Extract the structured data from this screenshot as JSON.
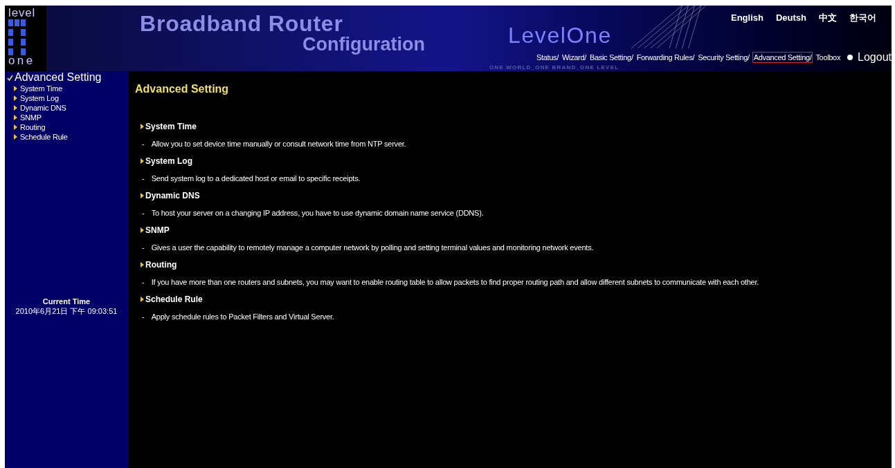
{
  "logo": {
    "top": "level",
    "bottom": "one"
  },
  "banner": {
    "title": "Broadband Router",
    "subtitle": "Configuration",
    "brand": "LevelOne",
    "slogan": "ONE WORLD_ONE BRAND_ONE LEVEL"
  },
  "languages": [
    "English",
    "Deutsh",
    "中文",
    "한국어"
  ],
  "nav": [
    {
      "label": "Status/",
      "selected": false
    },
    {
      "label": "Wizard/",
      "selected": false
    },
    {
      "label": "Basic Setting/",
      "selected": false
    },
    {
      "label": "Forwarding Rules/",
      "selected": false
    },
    {
      "label": "Security Setting/",
      "selected": false
    },
    {
      "label": "Advanced Setting/",
      "selected": true
    },
    {
      "label": "Toolbox",
      "selected": false
    }
  ],
  "logout": "Logout",
  "sidebar": {
    "title": "Advanced Setting",
    "items": [
      "System Time",
      "System Log",
      "Dynamic DNS",
      "SNMP",
      "Routing",
      "Schedule Rule"
    ],
    "clock_label": "Current Time",
    "clock_value": "2010年6月21日 下午 09:03:51"
  },
  "main": {
    "title": "Advanced Setting",
    "sections": [
      {
        "heading": "System Time",
        "marker": "-",
        "text": "Allow you to set device time manually or consult network time from NTP server."
      },
      {
        "heading": "System Log",
        "marker": "-",
        "text": "Send system log to a dedicated host or email to specific receipts."
      },
      {
        "heading": "Dynamic DNS",
        "marker": "-",
        "text": "To host your server on a changing IP address, you have to use dynamic domain name service (DDNS)."
      },
      {
        "heading": "SNMP",
        "marker": "-",
        "text": "Gives a user the capability to remotely manage a computer network by polling and setting terminal values and monitoring network events."
      },
      {
        "heading": "Routing",
        "marker": "-",
        "text": "If you have more than one routers and subnets, you may want to enable routing table to allow packets to find proper routing path and allow different subnets to communicate with each other."
      },
      {
        "heading": "Schedule Rule",
        "marker": "-",
        "text": "Apply schedule rules to Packet Filters and Virtual Server."
      }
    ]
  }
}
